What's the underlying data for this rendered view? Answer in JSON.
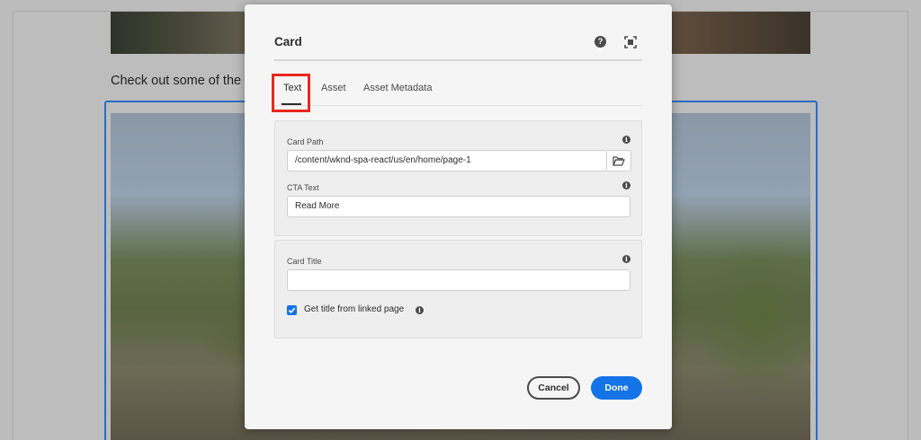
{
  "background": {
    "intro_text": "Check out some of the gr"
  },
  "dialog": {
    "title": "Card",
    "help_glyph": "?",
    "tabs": [
      {
        "label": "Text",
        "active": true
      },
      {
        "label": "Asset",
        "active": false
      },
      {
        "label": "Asset Metadata",
        "active": false
      }
    ],
    "card_path": {
      "label": "Card Path",
      "value": "/content/wknd-spa-react/us/en/home/page-1"
    },
    "cta_text": {
      "label": "CTA Text",
      "value": "Read More"
    },
    "card_title": {
      "label": "Card Title",
      "value": ""
    },
    "title_from_page": {
      "label": "Get title from linked page",
      "checked": true
    },
    "info_glyph": "i",
    "buttons": {
      "cancel": "Cancel",
      "done": "Done"
    }
  },
  "colors": {
    "accent": "#1473e6",
    "highlight": "#e8281e",
    "selection_outline": "#2b6cc4"
  }
}
